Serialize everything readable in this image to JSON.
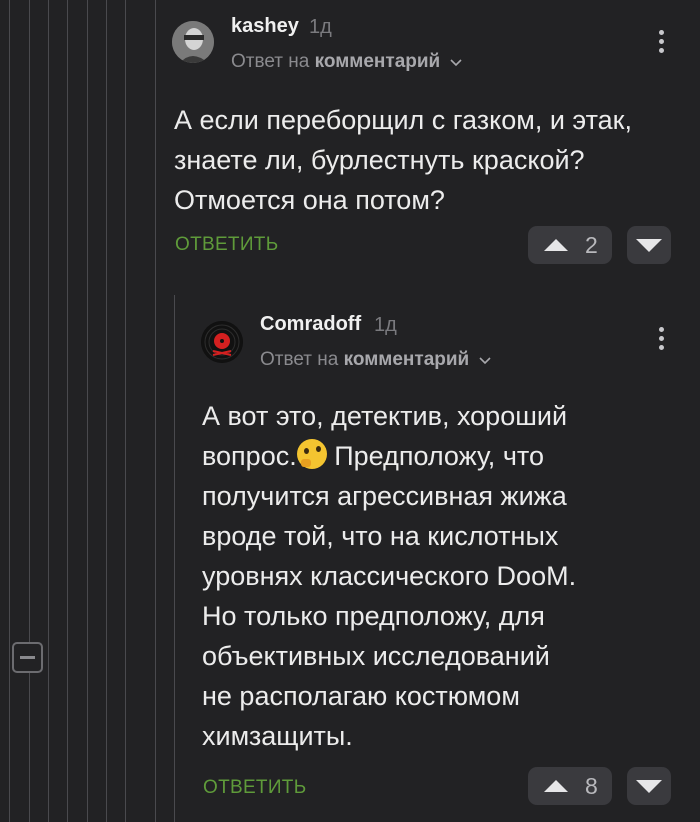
{
  "comments": [
    {
      "username": "kashey",
      "time": "1д",
      "reply_prefix": "Ответ на",
      "reply_target": "комментарий",
      "body_lines": [
        "А если переборщил с газком, и этак,",
        "знаете ли, бурлестнуть краской?",
        "Отмоется она потом?"
      ],
      "answer_label": "ОТВЕТИТЬ",
      "votes": "2"
    },
    {
      "username": "Comradoff",
      "time": "1д",
      "reply_prefix": "Ответ на",
      "reply_target": "комментарий",
      "body_lines": [
        "А вот это, детектив, хороший",
        "вопрос.",
        "Предположу, что",
        "получится агрессивная жижа",
        "вроде той, что на кислотных",
        "уровнях классического DooM.",
        "Но только предположу, для",
        "объективных исследований",
        "не располагаю костюмом",
        "химзащиты."
      ],
      "emoji": "thinking-face-emoji",
      "answer_label": "ОТВЕТИТЬ",
      "votes": "8"
    }
  ],
  "colors": {
    "background": "#222224",
    "accent_green": "#5f9b3a",
    "vote_bg": "#3a3a3e"
  }
}
